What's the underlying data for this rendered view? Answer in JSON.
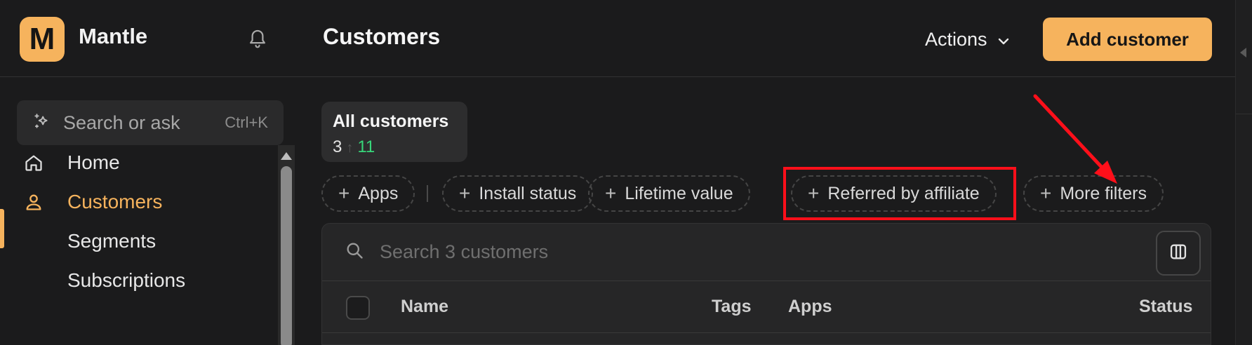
{
  "brand": {
    "logo_letter": "M",
    "name": "Mantle"
  },
  "header": {
    "title": "Customers",
    "actions_label": "Actions",
    "add_button_label": "Add customer"
  },
  "sidebar": {
    "search": {
      "label": "Search or ask",
      "shortcut": "Ctrl+K"
    },
    "items": [
      {
        "label": "Home",
        "icon": "home-icon",
        "active": false
      },
      {
        "label": "Customers",
        "icon": "user-icon",
        "active": true
      },
      {
        "label": "Segments",
        "icon": "",
        "active": false
      },
      {
        "label": "Subscriptions",
        "icon": "",
        "active": false
      }
    ]
  },
  "segment": {
    "title": "All customers",
    "count": "3",
    "trend_count": "11"
  },
  "filters": [
    {
      "label": "Apps"
    },
    {
      "label": "Install status"
    },
    {
      "label": "Lifetime value"
    },
    {
      "label": "Referred by affiliate"
    },
    {
      "label": "More filters"
    }
  ],
  "table": {
    "search_placeholder": "Search 3 customers",
    "columns": [
      "Name",
      "Tags",
      "Apps",
      "Status"
    ]
  },
  "colors": {
    "accent": "#f6b35d",
    "background": "#1b1b1c",
    "annotation": "#ff0f1a",
    "positive": "#37d67a"
  }
}
